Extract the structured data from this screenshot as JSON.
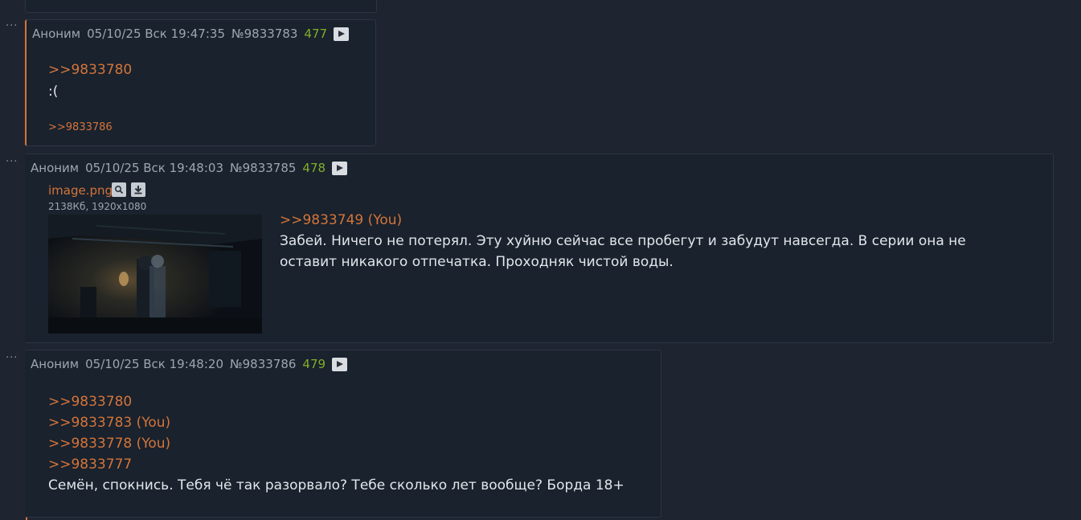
{
  "posts": [
    {
      "author": "Аноним",
      "date": "05/10/25 Вск 19:47:35",
      "number": "№9833783",
      "count": "477",
      "lines": [
        ">>9833780",
        ":("
      ],
      "backlinks": [
        ">>9833786"
      ]
    },
    {
      "author": "Аноним",
      "date": "05/10/25 Вск 19:48:03",
      "number": "№9833785",
      "count": "478",
      "file": {
        "name": "image.png",
        "meta": "2138Кб, 1920x1080"
      },
      "reply": ">>9833749 (You)",
      "text_lines": [
        "Забей. Ничего не потерял. Эту хуйню сейчас все пробегут и забудут навсегда. В серии она не",
        "оставит никакого отпечатка. Проходняк чистой воды."
      ]
    },
    {
      "author": "Аноним",
      "date": "05/10/25 Вск 19:48:20",
      "number": "№9833786",
      "count": "479",
      "replies": [
        ">>9833780",
        ">>9833783 (You)",
        ">>9833778 (You)",
        ">>9833777"
      ],
      "text": "Семён, спокнись. Тебя чё так разорвало? Тебе сколько лет вообще? Борда 18+"
    }
  ],
  "icons": {
    "menu": "more-dots-icon",
    "play": "play-icon",
    "search": "search-icon",
    "download": "download-icon"
  },
  "colors": {
    "background": "#1e2530",
    "post": "#19222d",
    "link": "#d5743a",
    "count": "#82ae28",
    "meta": "#9ea6b0",
    "text": "#e2e6ea"
  }
}
